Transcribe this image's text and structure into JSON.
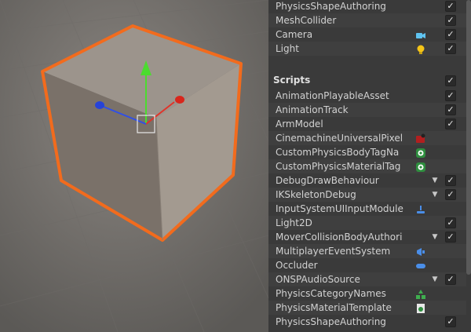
{
  "scene_view": {
    "gizmo_axes": [
      "y-axis-green",
      "x-axis-red",
      "z-axis-blue"
    ]
  },
  "inspector": {
    "top_rows": [
      {
        "label": "PhysicsShapeAuthoring",
        "icon": null,
        "checked": true
      },
      {
        "label": "MeshCollider",
        "icon": null,
        "checked": true
      },
      {
        "label": "Camera",
        "icon": "camera-icon",
        "checked": true
      },
      {
        "label": "Light",
        "icon": "lightbulb-icon",
        "checked": true
      }
    ],
    "section_title": "Scripts",
    "section_checked": true,
    "script_rows": [
      {
        "label": "AnimationPlayableAsset",
        "icon": null,
        "arrow": false,
        "checked": true
      },
      {
        "label": "AnimationTrack",
        "icon": null,
        "arrow": false,
        "checked": true
      },
      {
        "label": "ArmModel",
        "icon": null,
        "arrow": false,
        "checked": true
      },
      {
        "label": "CinemachineUniversalPixel",
        "icon": "cinemachine-icon",
        "arrow": false,
        "checked": false
      },
      {
        "label": "CustomPhysicsBodyTagNa",
        "icon": "physics-tag-icon",
        "arrow": false,
        "checked": false
      },
      {
        "label": "CustomPhysicsMaterialTag",
        "icon": "physics-tag-icon",
        "arrow": false,
        "checked": false
      },
      {
        "label": "DebugDrawBehaviour",
        "icon": null,
        "arrow": true,
        "checked": true
      },
      {
        "label": "IKSkeletonDebug",
        "icon": null,
        "arrow": true,
        "checked": true
      },
      {
        "label": "InputSystemUIInputModule",
        "icon": "input-module-icon",
        "arrow": false,
        "checked": false
      },
      {
        "label": "Light2D",
        "icon": null,
        "arrow": false,
        "checked": true
      },
      {
        "label": "MoverCollisionBodyAuthori",
        "icon": null,
        "arrow": true,
        "checked": true
      },
      {
        "label": "MultiplayerEventSystem",
        "icon": "event-system-icon",
        "arrow": false,
        "checked": false
      },
      {
        "label": "Occluder",
        "icon": "occluder-icon",
        "arrow": false,
        "checked": false
      },
      {
        "label": "ONSPAudioSource",
        "icon": null,
        "arrow": true,
        "checked": true
      },
      {
        "label": "PhysicsCategoryNames",
        "icon": "category-names-icon",
        "arrow": false,
        "checked": false
      },
      {
        "label": "PhysicsMaterialTemplate",
        "icon": "material-template-icon",
        "arrow": false,
        "checked": false
      },
      {
        "label": "PhysicsShapeAuthoring",
        "icon": null,
        "arrow": false,
        "checked": true
      }
    ],
    "check_glyph": "✓",
    "arrow_glyph": "▼"
  },
  "colors": {
    "selection_outline": "#f26b1d",
    "cube_top": "#9c948c",
    "cube_left": "#7a7169",
    "cube_right": "#a39a90"
  }
}
